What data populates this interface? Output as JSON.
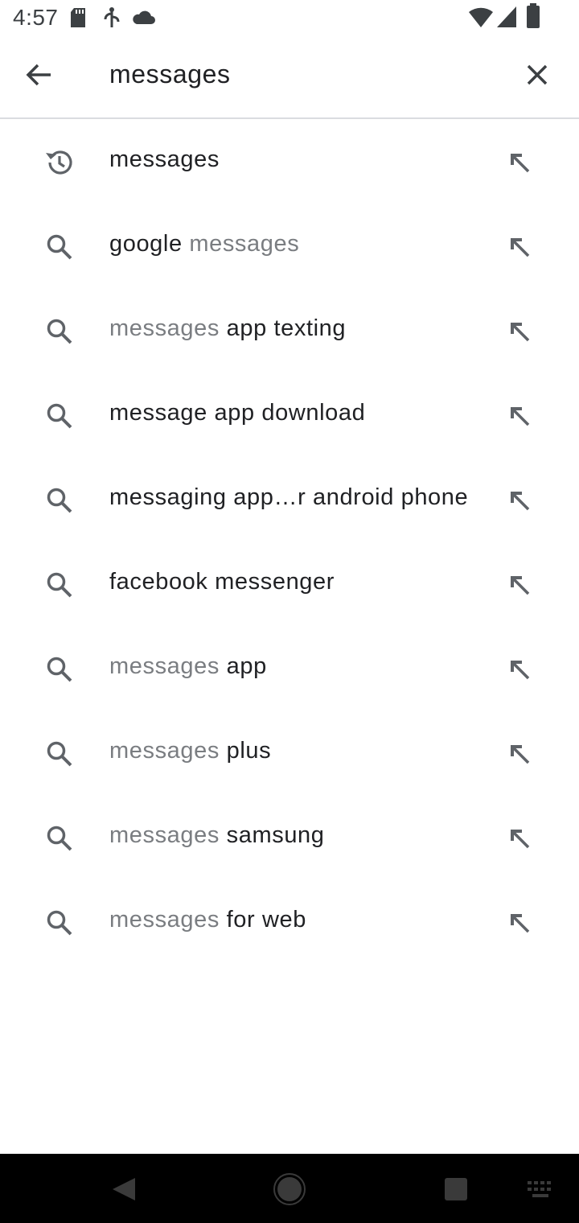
{
  "status_bar": {
    "time": "4:57",
    "left_icons": [
      "sd-card-icon",
      "usb-icon",
      "cloud-icon"
    ],
    "right_icons": [
      "wifi-icon",
      "signal-icon",
      "battery-icon"
    ]
  },
  "search": {
    "query": "messages",
    "back_icon": "arrow-back-icon",
    "clear_icon": "close-icon"
  },
  "suggestions": [
    {
      "type": "history",
      "icon": "history-icon",
      "parts": [
        {
          "text": "messages",
          "style": "b"
        }
      ]
    },
    {
      "type": "search",
      "icon": "search-icon",
      "parts": [
        {
          "text": "google ",
          "style": "b"
        },
        {
          "text": "messages",
          "style": "m"
        }
      ]
    },
    {
      "type": "search",
      "icon": "search-icon",
      "parts": [
        {
          "text": "messages ",
          "style": "m"
        },
        {
          "text": "app texting",
          "style": "b"
        }
      ]
    },
    {
      "type": "search",
      "icon": "search-icon",
      "parts": [
        {
          "text": "message app download",
          "style": "b"
        }
      ]
    },
    {
      "type": "search",
      "icon": "search-icon",
      "parts": [
        {
          "text": "messaging app…r android phone",
          "style": "b"
        }
      ]
    },
    {
      "type": "search",
      "icon": "search-icon",
      "parts": [
        {
          "text": "facebook messenger",
          "style": "b"
        }
      ]
    },
    {
      "type": "search",
      "icon": "search-icon",
      "parts": [
        {
          "text": "messages ",
          "style": "m"
        },
        {
          "text": "app",
          "style": "b"
        }
      ]
    },
    {
      "type": "search",
      "icon": "search-icon",
      "parts": [
        {
          "text": "messages ",
          "style": "m"
        },
        {
          "text": "plus",
          "style": "b"
        }
      ]
    },
    {
      "type": "search",
      "icon": "search-icon",
      "parts": [
        {
          "text": "messages ",
          "style": "m"
        },
        {
          "text": "samsung",
          "style": "b"
        }
      ]
    },
    {
      "type": "search",
      "icon": "search-icon",
      "parts": [
        {
          "text": "messages ",
          "style": "m"
        },
        {
          "text": "for web",
          "style": "b"
        }
      ]
    }
  ],
  "nav_bar": {
    "buttons": [
      "back-nav-icon",
      "home-nav-icon",
      "recents-nav-icon",
      "keyboard-icon"
    ]
  },
  "colors": {
    "text_primary": "#202124",
    "text_match": "#7a7d81",
    "icon": "#5f6368",
    "divider": "#dadce0",
    "nav_bar": "#000000"
  }
}
